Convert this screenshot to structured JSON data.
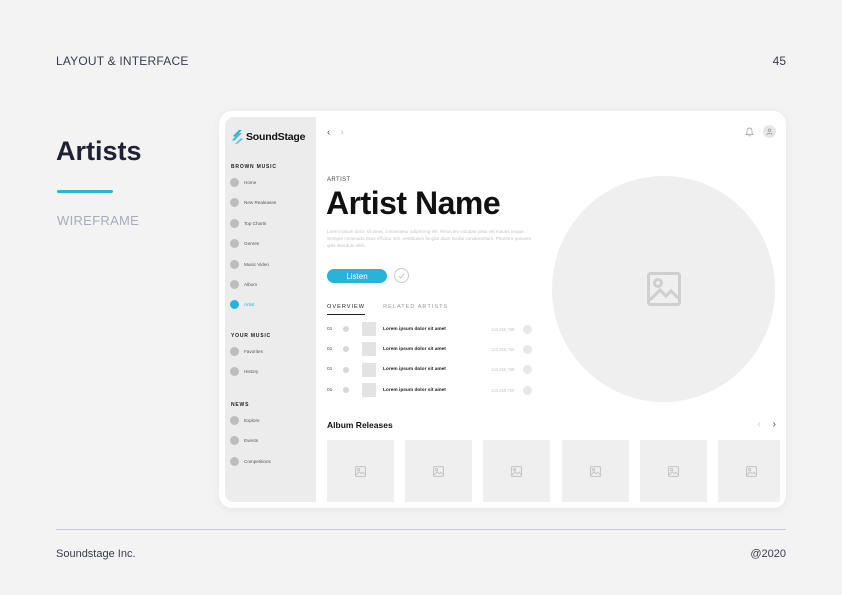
{
  "slide": {
    "header": "LAYOUT & INTERFACE",
    "page_number": "45",
    "title": "Artists",
    "subtitle": "WIREFRAME",
    "footer_left": "Soundstage Inc.",
    "footer_right": "@2020",
    "accent_color": "#27b4d8"
  },
  "app": {
    "logo_text": "SoundStage",
    "sidebar": {
      "sections": [
        {
          "label": "BROWN MUSIC",
          "items": [
            "Home",
            "New Realeases",
            "Top Charts",
            "Genres",
            "Music Video",
            "Album",
            "Artist"
          ]
        },
        {
          "label": "YOUR MUSIC",
          "items": [
            "Favorites",
            "History"
          ]
        },
        {
          "label": "NEWS",
          "items": [
            "Explore",
            "Events",
            "Competitions"
          ]
        }
      ],
      "active_item": "Artist"
    },
    "nav": {
      "back": "‹",
      "forward": "›",
      "icons": [
        "bell-icon",
        "user-icon"
      ]
    },
    "artist": {
      "kicker": "ARTIST",
      "name": "Artist Name",
      "description": "Lorem ipsum dolor sit amet, consectetur adipiscing elit. Risus leo volutpat justo vel mauris neque. Semper commodo risus efficitur nisl, vestibulum feugiat diam facilisi condimentum. Pharetra posuere quis interdum nibh.",
      "listen_label": "Listen"
    },
    "tabs": [
      "OVERVIEW",
      "RELATED ARTISTS"
    ],
    "active_tab": "OVERVIEW",
    "tracks": [
      {
        "num": "01",
        "title": "Lorem ipsum dolor sit amet",
        "count": "123,456,789"
      },
      {
        "num": "01",
        "title": "Lorem ipsum dolor sit amet",
        "count": "123,456,789"
      },
      {
        "num": "01",
        "title": "Lorem ipsum dolor sit amet",
        "count": "123,456,789"
      },
      {
        "num": "01",
        "title": "Lorem ipsum dolor sit amet",
        "count": "123,456,789"
      }
    ],
    "album_section": {
      "title": "Album Releases",
      "prev": "‹",
      "next": "›",
      "card_count": 6
    }
  }
}
